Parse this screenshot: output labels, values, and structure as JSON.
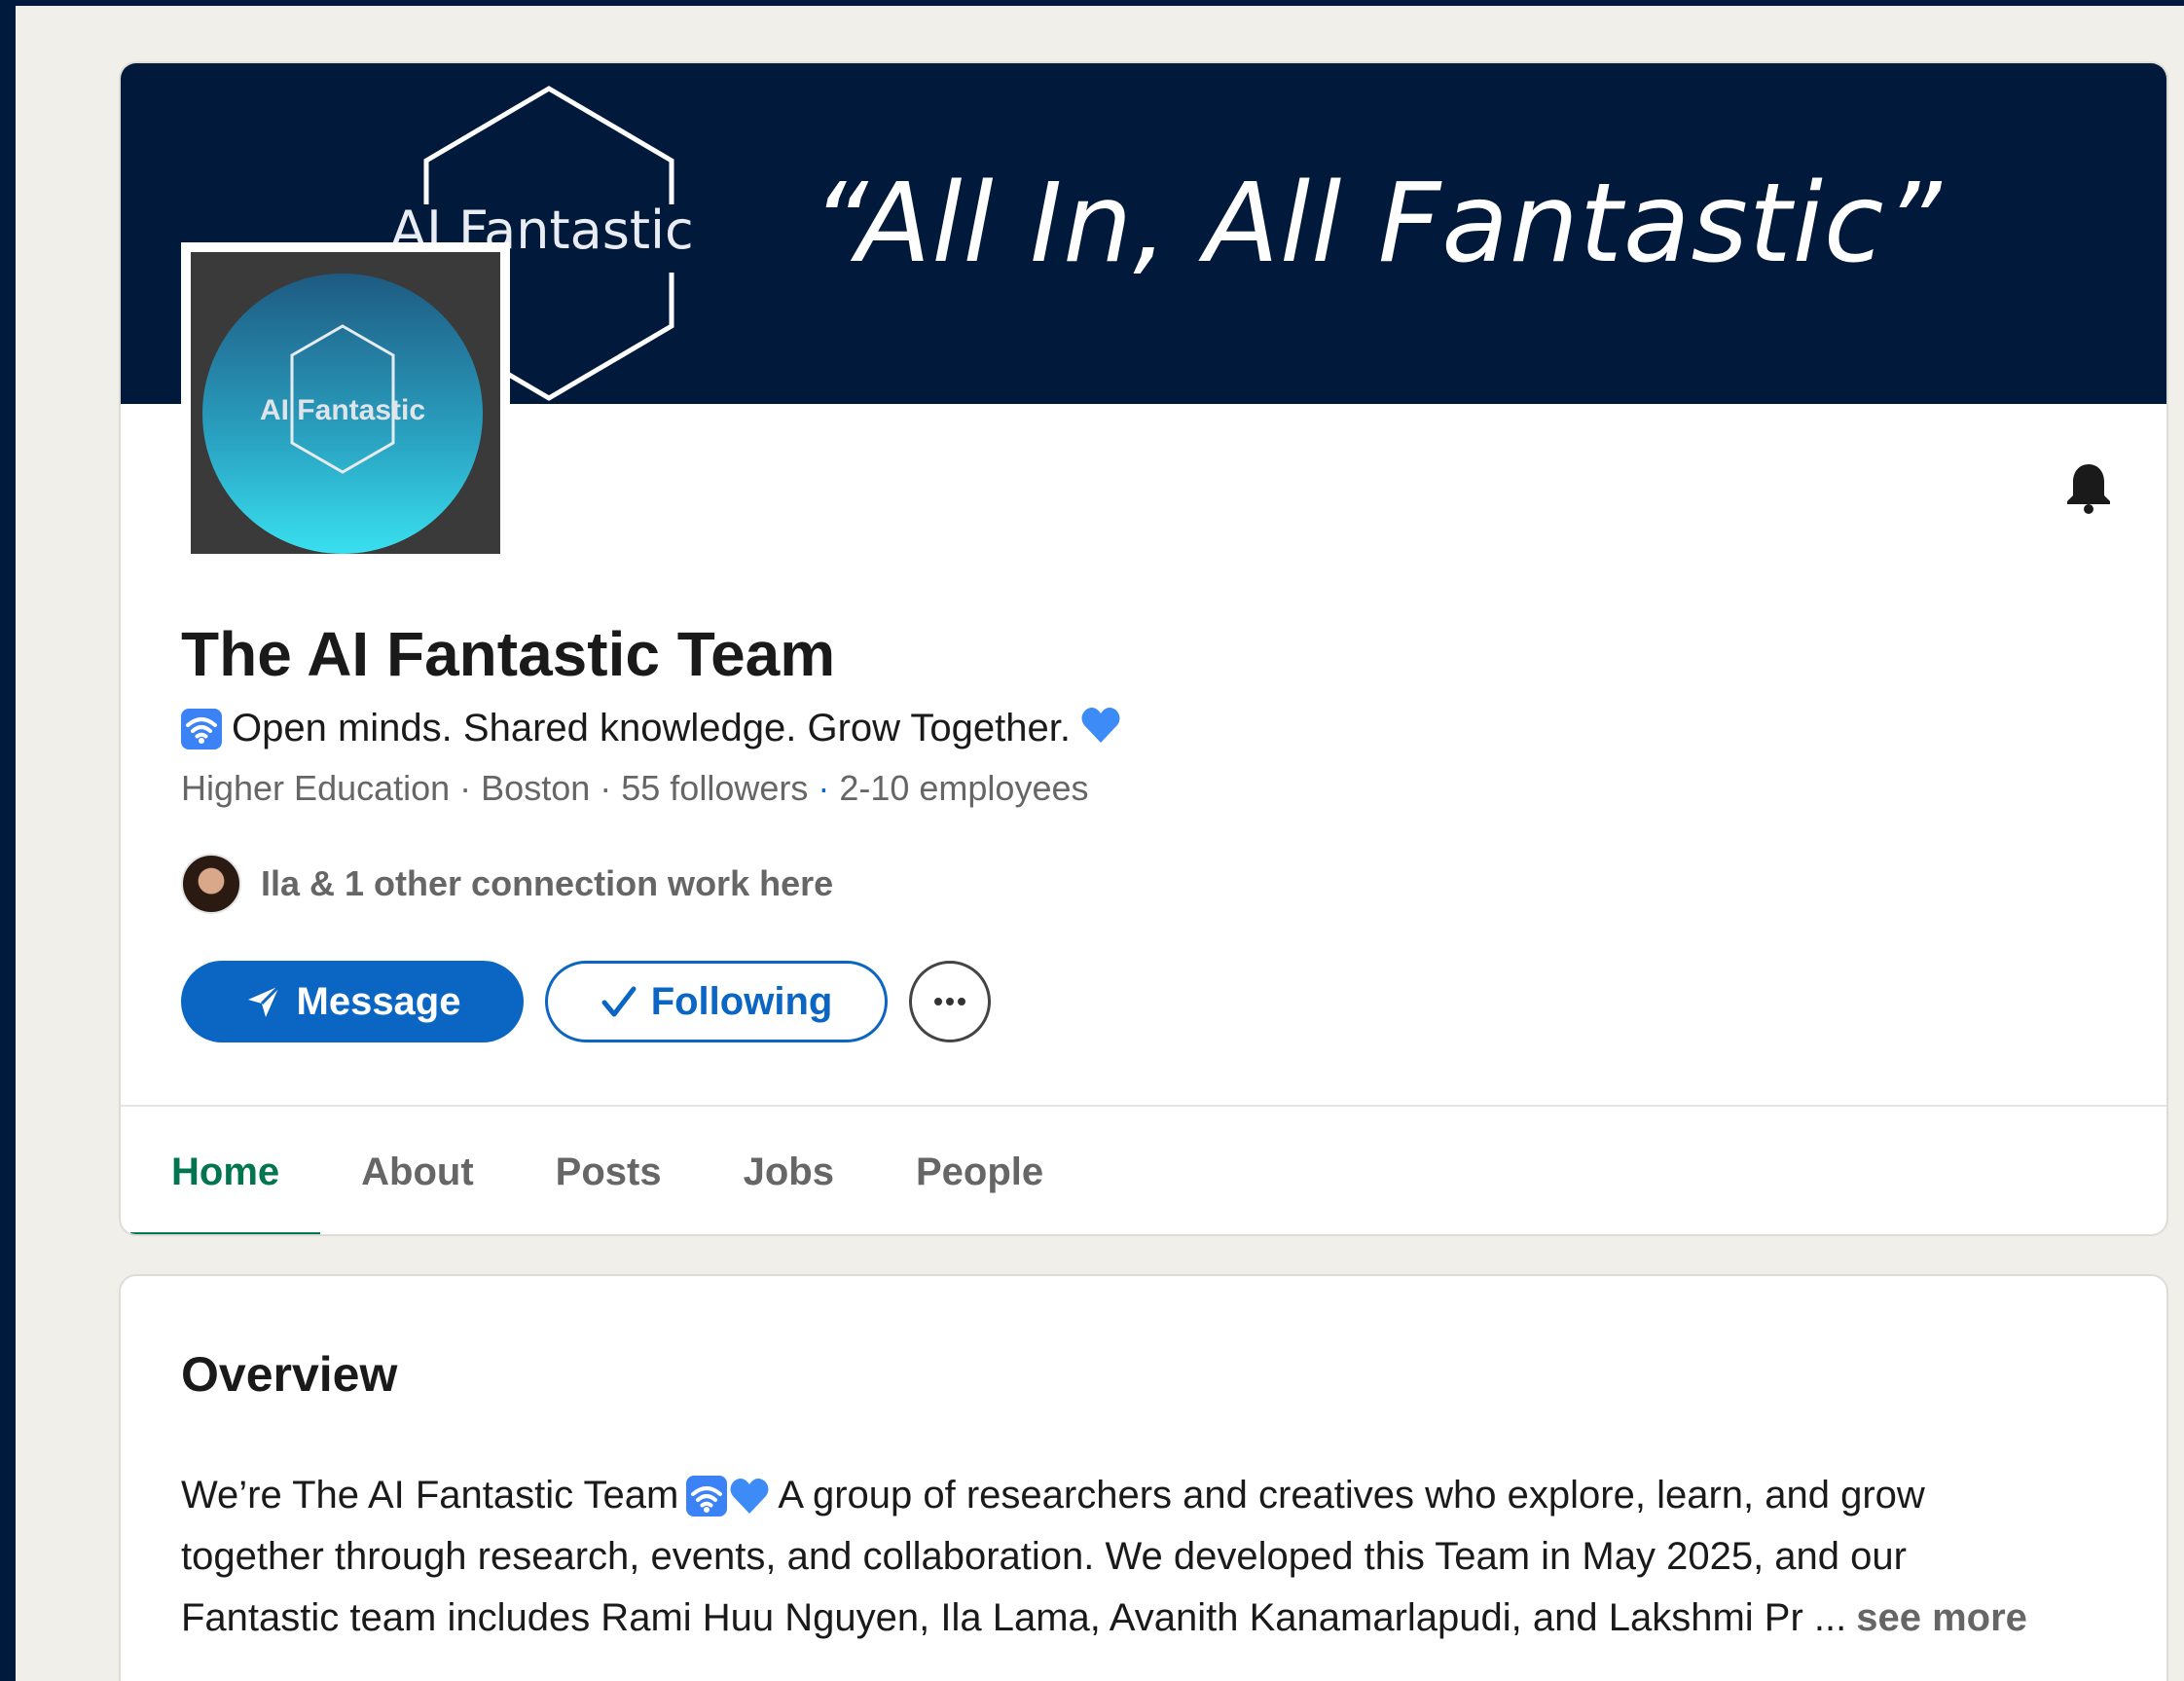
{
  "banner": {
    "brand": "AI Fantastic",
    "tagline": "“All In, All Fantastic”"
  },
  "logo": {
    "text": "AI Fantastic"
  },
  "profile": {
    "name": "The AI Fantastic Team",
    "tagline": "Open minds. Shared knowledge. Grow Together.",
    "industry": "Higher Education",
    "location": "Boston",
    "followers": "55 followers",
    "employees": "2-10 employees",
    "connections": "Ila & 1 other connection work here"
  },
  "actions": {
    "message_label": "Message",
    "following_label": "Following"
  },
  "tabs": [
    {
      "label": "Home",
      "active": true
    },
    {
      "label": "About",
      "active": false
    },
    {
      "label": "Posts",
      "active": false
    },
    {
      "label": "Jobs",
      "active": false
    },
    {
      "label": "People",
      "active": false
    }
  ],
  "overview": {
    "title": "Overview",
    "line1_start": "We’re The AI Fantastic Team",
    "line1_end": "A group of researchers and creatives who explore, learn, and grow",
    "line2": "together through research, events, and collaboration. We developed this Team in May 2025, and our",
    "line3": "Fantastic team includes Rami Huu Nguyen, Ila Lama, Avanith Kanamarlapudi, and Lakshmi Pr ...",
    "see_more": "see more"
  },
  "colors": {
    "banner_bg": "#011a3c",
    "primary": "#0a66c2",
    "active_tab": "#01754f",
    "page_bg": "#f0efea"
  }
}
